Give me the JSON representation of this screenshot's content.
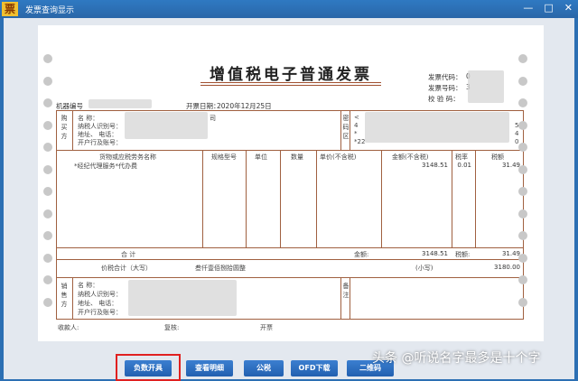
{
  "app": {
    "icon_glyph": "票",
    "title": "发票查询显示",
    "minimize": "—",
    "maximize": "□",
    "close": "✕"
  },
  "invoice": {
    "title": "增值税电子普通发票",
    "code_label": "发票代码：",
    "code_value": "0",
    "number_label": "发票号码：",
    "number_value": "3",
    "check_label": "校 验 码：",
    "machine_label": "机器编号",
    "date_label": "开票日期：",
    "date_value": "2020年12月25日",
    "buyer_side": "购买方",
    "buyer_name_label": "名      称：",
    "buyer_name_suffix": "司",
    "buyer_taxid_label": "纳税人识别号：",
    "buyer_addr_label": "地址、   电话：",
    "buyer_bank_label": "开户行及账号：",
    "secret_side": "密码区",
    "secret_chars": [
      "<",
      "4",
      "*",
      "*22"
    ],
    "secret_right": [
      "5",
      "4",
      "0"
    ],
    "col_item": "货物或应税劳务名称",
    "col_spec": "规格型号",
    "col_unit": "单位",
    "col_qty": "数量",
    "col_price": "单价(不含税)",
    "col_amount": "金额(不含税)",
    "col_rate": "税率",
    "col_tax": "税额",
    "item_name": "*经纪代理服务*代办费",
    "item_amount": "3148.51",
    "item_rate": "0.01",
    "item_tax": "31.49",
    "total_label": "合      计",
    "total_amount_label": "金额:",
    "total_amount": "3148.51",
    "total_tax_label": "税额:",
    "total_tax": "31.49",
    "grand_label": "价税合计（大写）",
    "grand_words": "叁仟壹佰捌拾圆整",
    "grand_small_label": "(小写)",
    "grand_small": "3180.00",
    "seller_side": "销售方",
    "seller_name_label": "名      称：",
    "seller_taxid_label": "纳税人识别号：",
    "seller_addr_label": "地址、   电话：",
    "seller_bank_label": "开户行及账号：",
    "remark_side": "备注",
    "payee_label": "收款人:",
    "review_label": "复核:",
    "issuer_label": "开票"
  },
  "toolbar": {
    "buttons": [
      "负数开具",
      "查看明细",
      "公税",
      "OFD下载",
      "二维码"
    ]
  },
  "watermark": "头条 @听说名字最多是十个字",
  "colors": {
    "titlebar": "#2a67a8",
    "button": "#2260b0",
    "highlight": "#e02020",
    "border": "#a06040"
  }
}
